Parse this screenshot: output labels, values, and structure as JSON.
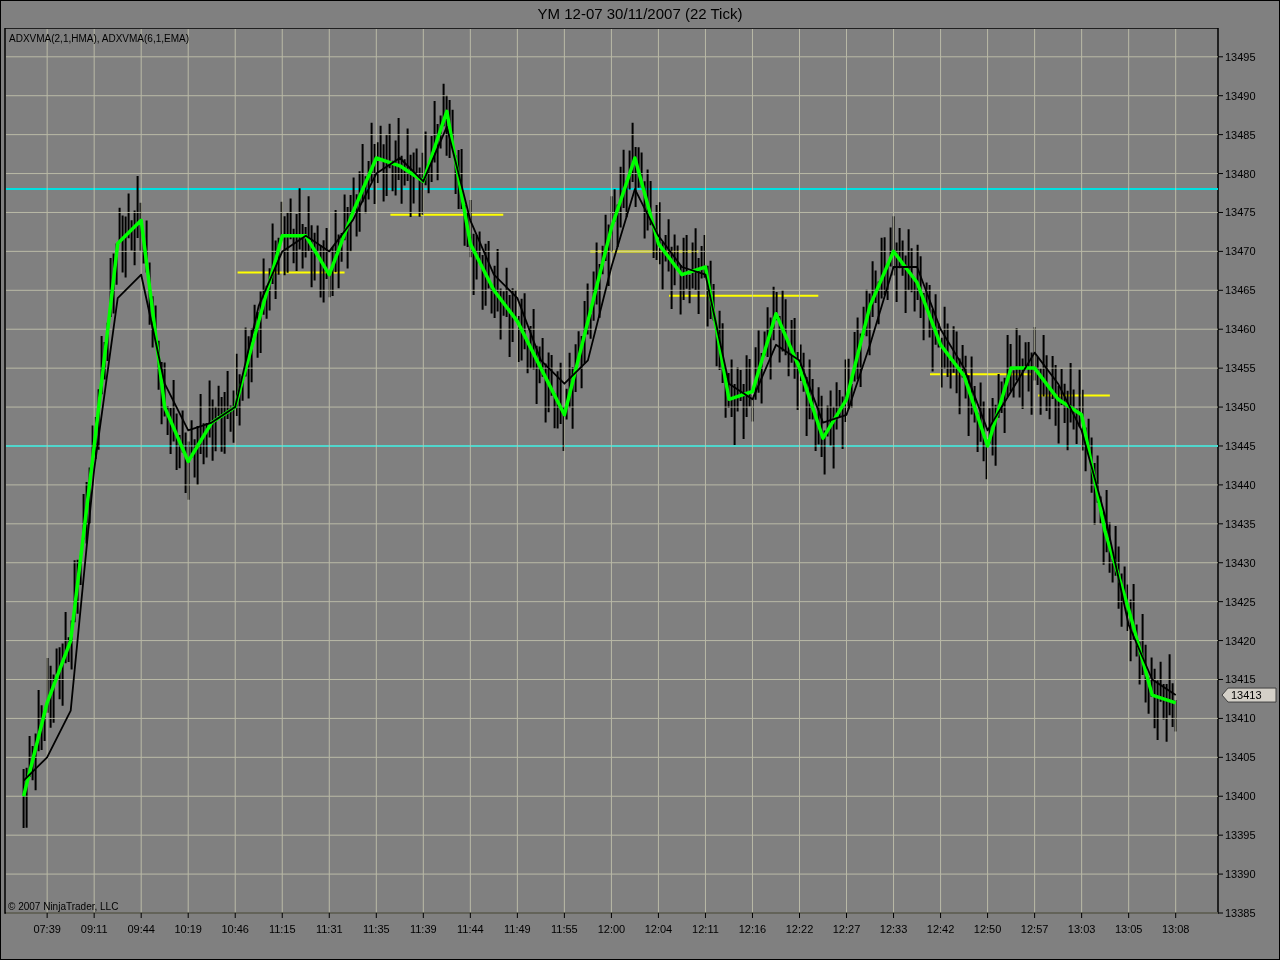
{
  "window": {
    "title": "YM 12-07  30/11/2007  (22 Tick)"
  },
  "chart": {
    "legend": "ADXVMA(2,1,HMA), ADXVMA(6,1,EMA)",
    "copyright": "© 2007 NinjaTrader, LLC",
    "last_price": "13413",
    "chart_data": {
      "type": "line",
      "categories": [
        null,
        "07:39",
        null,
        "09:11",
        null,
        "09:44",
        null,
        "10:19",
        null,
        "10:46",
        null,
        "11:15",
        null,
        "11:31",
        null,
        "11:35",
        null,
        "11:39",
        null,
        "11:44",
        null,
        "11:49",
        null,
        "11:55",
        null,
        "12:00",
        null,
        "12:04",
        null,
        "12:11",
        null,
        "12:16",
        null,
        "12:22",
        null,
        "12:27",
        null,
        "12:33",
        null,
        "12:42",
        null,
        "12:50",
        null,
        "12:57",
        null,
        "13:03",
        null,
        "13:05",
        null,
        "13:08"
      ],
      "series": [
        {
          "color": "#00ff00",
          "values": [
            13400,
            13412,
            13420,
            13445,
            13471,
            13474,
            13450,
            13443,
            13448,
            13450,
            13461,
            13472,
            13472,
            13467,
            13475,
            13482,
            13481,
            13479,
            13488,
            13471,
            13465,
            13461,
            13455,
            13449,
            13461,
            13473,
            13482,
            13471,
            13467,
            13468,
            13451,
            13452,
            13462,
            13455,
            13446,
            13451,
            13463,
            13470,
            13466,
            13458,
            13454,
            13445,
            13455,
            13455,
            13451,
            13449,
            13434,
            13424,
            13413,
            13412
          ]
        },
        {
          "color": "#000000",
          "values": [
            13402,
            13405,
            13411,
            13442,
            13464,
            13467,
            13453,
            13447,
            13448,
            13450,
            13463,
            13470,
            13472,
            13470,
            13474,
            13480,
            13482,
            13479,
            13486,
            13474,
            13467,
            13464,
            13456,
            13453,
            13456,
            13468,
            13478,
            13472,
            13468,
            13467,
            13453,
            13451,
            13458,
            13456,
            13448,
            13449,
            13458,
            13468,
            13468,
            13460,
            13455,
            13447,
            13452,
            13457,
            13453,
            13447,
            13436,
            13422,
            13415,
            13413
          ]
        }
      ],
      "grid": true,
      "ylim": [
        13385,
        13498.7
      ],
      "yticks": [
        13385,
        13390,
        13395,
        13400,
        13405,
        13410,
        13415,
        13420,
        13425,
        13430,
        13435,
        13440,
        13445,
        13450,
        13455,
        13460,
        13465,
        13470,
        13475,
        13480,
        13485,
        13490,
        13495
      ]
    }
  }
}
